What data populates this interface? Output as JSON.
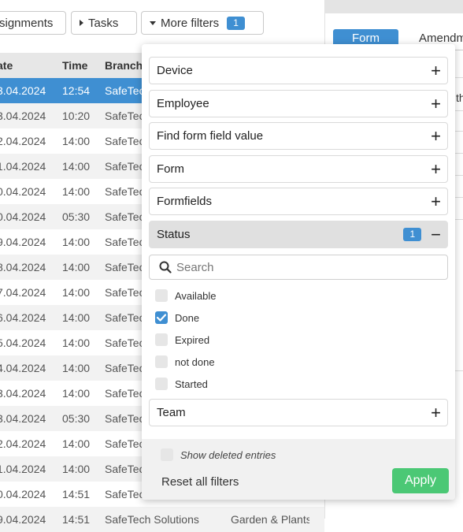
{
  "toolbar": {
    "assignments_label": "signments",
    "tasks_label": "Tasks",
    "more_filters_label": "More filters",
    "more_filters_count": "1"
  },
  "right_panel": {
    "tab_form": "Form",
    "tab_amendments": "Amendm",
    "cell_partial": "th"
  },
  "table": {
    "headers": [
      "ate",
      "Time",
      "Branch"
    ],
    "rows": [
      {
        "date": "3.04.2024",
        "time": "12:54",
        "branch": "SafeTec"
      },
      {
        "date": "3.04.2024",
        "time": "10:20",
        "branch": "SafeTec"
      },
      {
        "date": "2.04.2024",
        "time": "14:00",
        "branch": "SafeTec"
      },
      {
        "date": "1.04.2024",
        "time": "14:00",
        "branch": "SafeTec"
      },
      {
        "date": "0.04.2024",
        "time": "14:00",
        "branch": "SafeTec"
      },
      {
        "date": "0.04.2024",
        "time": "05:30",
        "branch": "SafeTec"
      },
      {
        "date": "9.04.2024",
        "time": "14:00",
        "branch": "SafeTec"
      },
      {
        "date": "8.04.2024",
        "time": "14:00",
        "branch": "SafeTec"
      },
      {
        "date": "7.04.2024",
        "time": "14:00",
        "branch": "SafeTec"
      },
      {
        "date": "6.04.2024",
        "time": "14:00",
        "branch": "SafeTec"
      },
      {
        "date": "5.04.2024",
        "time": "14:00",
        "branch": "SafeTec"
      },
      {
        "date": "4.04.2024",
        "time": "14:00",
        "branch": "SafeTec"
      },
      {
        "date": "3.04.2024",
        "time": "14:00",
        "branch": "SafeTec"
      },
      {
        "date": "3.04.2024",
        "time": "05:30",
        "branch": "SafeTec"
      },
      {
        "date": "2.04.2024",
        "time": "14:00",
        "branch": "SafeTec"
      },
      {
        "date": "1.04.2024",
        "time": "14:00",
        "branch": "SafeTec"
      },
      {
        "date": "0.04.2024",
        "time": "14:51",
        "branch": "SafeTec"
      },
      {
        "date": "9.04.2024",
        "time": "14:51",
        "branch": "SafeTech Solutions",
        "extra": "Garden & Plants"
      }
    ]
  },
  "filters": {
    "facets": [
      {
        "label": "Device"
      },
      {
        "label": "Employee"
      },
      {
        "label": "Find form field value"
      },
      {
        "label": "Form"
      },
      {
        "label": "Formfields"
      }
    ],
    "status": {
      "label": "Status",
      "count": "1",
      "search_placeholder": "Search",
      "options": [
        {
          "label": "Available",
          "checked": false
        },
        {
          "label": "Done",
          "checked": true
        },
        {
          "label": "Expired",
          "checked": false
        },
        {
          "label": "not done",
          "checked": false
        },
        {
          "label": "Started",
          "checked": false
        }
      ]
    },
    "team_label": "Team",
    "show_deleted_label": "Show deleted entries",
    "reset_label": "Reset all filters",
    "apply_label": "Apply"
  },
  "colors": {
    "accent": "#3f8fd2",
    "apply": "#4bc875"
  }
}
